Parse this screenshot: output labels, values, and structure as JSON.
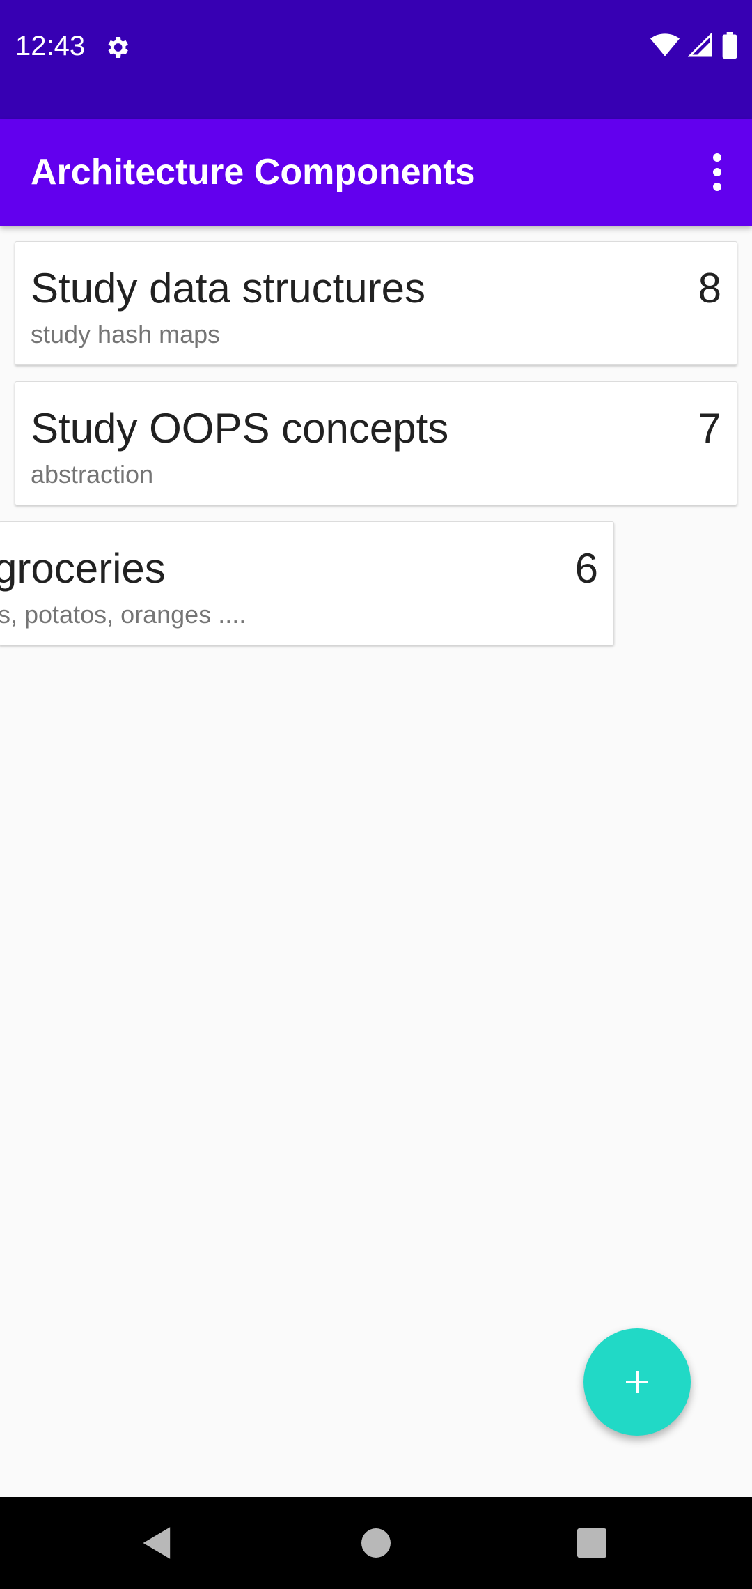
{
  "status_bar": {
    "time": "12:43",
    "icons": [
      "gear-icon",
      "wifi-icon",
      "signal-icon",
      "battery-icon"
    ]
  },
  "app_bar": {
    "title": "Architecture Components",
    "menu_icon": "more-vert-icon"
  },
  "notes": [
    {
      "title": "Study data structures",
      "description": "study hash maps",
      "priority": "8"
    },
    {
      "title": "Study OOPS concepts",
      "description": "abstraction",
      "priority": "7"
    },
    {
      "title": "groceries",
      "description": "s, potatos, oranges ....",
      "priority": "6"
    }
  ],
  "fab": {
    "icon": "add-icon"
  },
  "nav_bar": {
    "icons": [
      "back-icon",
      "home-icon",
      "recents-icon"
    ]
  },
  "colors": {
    "status_bar": "#3700b3",
    "app_bar": "#6200ee",
    "fab": "#21d9c6",
    "background": "#fafafa"
  }
}
